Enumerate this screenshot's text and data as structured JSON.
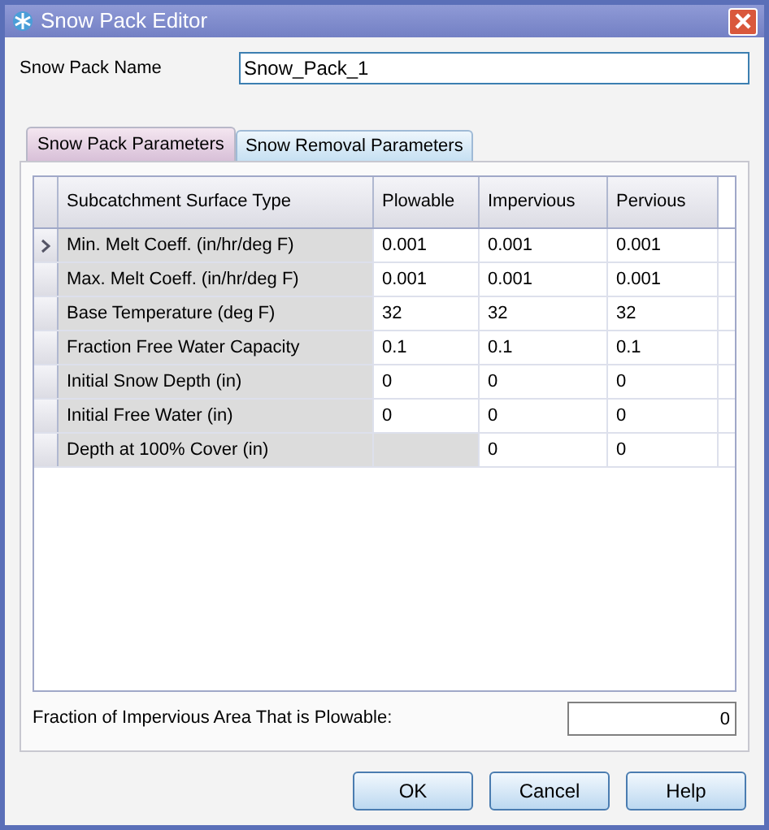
{
  "window": {
    "title": "Snow Pack Editor"
  },
  "name_field": {
    "label": "Snow Pack Name",
    "value": "Snow_Pack_1"
  },
  "tabs": [
    {
      "label": "Snow Pack Parameters",
      "selected": true
    },
    {
      "label": "Snow Removal Parameters",
      "selected": false
    }
  ],
  "table": {
    "columns": [
      "Subcatchment Surface Type",
      "Plowable",
      "Impervious",
      "Pervious"
    ],
    "rows": [
      {
        "selected": true,
        "cells": [
          {
            "text": "Min. Melt Coeff. (in/hr/deg F)",
            "disabled": true
          },
          {
            "text": "0.001",
            "disabled": false
          },
          {
            "text": "0.001",
            "disabled": false
          },
          {
            "text": "0.001",
            "disabled": false
          }
        ]
      },
      {
        "selected": false,
        "cells": [
          {
            "text": "Max. Melt Coeff. (in/hr/deg F)",
            "disabled": true
          },
          {
            "text": "0.001",
            "disabled": false
          },
          {
            "text": "0.001",
            "disabled": false
          },
          {
            "text": "0.001",
            "disabled": false
          }
        ]
      },
      {
        "selected": false,
        "cells": [
          {
            "text": "Base Temperature (deg F)",
            "disabled": true
          },
          {
            "text": "32",
            "disabled": false
          },
          {
            "text": "32",
            "disabled": false
          },
          {
            "text": "32",
            "disabled": false
          }
        ]
      },
      {
        "selected": false,
        "cells": [
          {
            "text": "Fraction Free Water Capacity",
            "disabled": true
          },
          {
            "text": "0.1",
            "disabled": false
          },
          {
            "text": "0.1",
            "disabled": false
          },
          {
            "text": "0.1",
            "disabled": false
          }
        ]
      },
      {
        "selected": false,
        "cells": [
          {
            "text": "Initial Snow Depth (in)",
            "disabled": true
          },
          {
            "text": "0",
            "disabled": false
          },
          {
            "text": "0",
            "disabled": false
          },
          {
            "text": "0",
            "disabled": false
          }
        ]
      },
      {
        "selected": false,
        "cells": [
          {
            "text": "Initial Free Water (in)",
            "disabled": true
          },
          {
            "text": "0",
            "disabled": false
          },
          {
            "text": "0",
            "disabled": false
          },
          {
            "text": "0",
            "disabled": false
          }
        ]
      },
      {
        "selected": false,
        "cells": [
          {
            "text": "Depth at 100% Cover (in)",
            "disabled": true
          },
          {
            "text": "",
            "disabled": true
          },
          {
            "text": "0",
            "disabled": false
          },
          {
            "text": "0",
            "disabled": false
          }
        ]
      }
    ]
  },
  "fraction_field": {
    "label": "Fraction of Impervious Area That is Plowable:",
    "value": "0"
  },
  "buttons": [
    "OK",
    "Cancel",
    "Help"
  ]
}
